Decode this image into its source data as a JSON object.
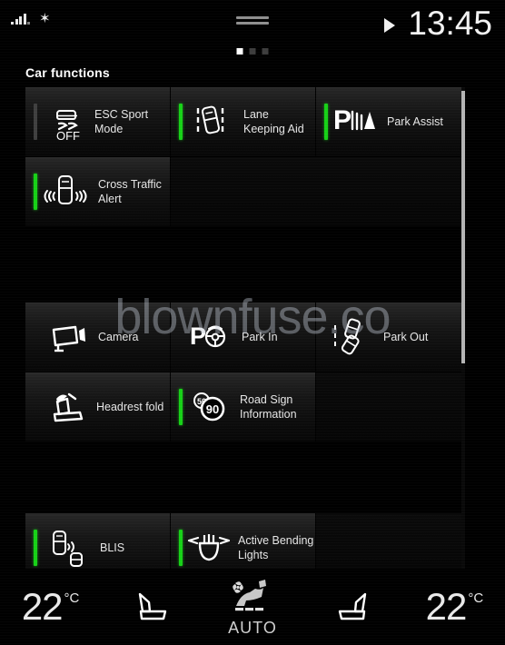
{
  "status_bar": {
    "signal_icon": "cellular-signal-icon",
    "bluetooth_icon": "bluetooth-icon",
    "bluetooth_glyph": "✶",
    "media_play_icon": "play-icon",
    "clock": "13:45",
    "drag_handle_icon": "drag-handle-icon"
  },
  "page_dots": {
    "count": 3,
    "active_index": 0
  },
  "header": {
    "title": "Car functions"
  },
  "scrollbar": {
    "name": "vertical-scrollbar",
    "position": "top"
  },
  "watermark": {
    "text": "blownfuse.co"
  },
  "tiles": {
    "rows": [
      {
        "row_name": "row-1",
        "items": [
          {
            "label": "ESC Sport Mode",
            "icon": "esc-sport-mode-icon",
            "status": "off",
            "sub_text": "OFF"
          },
          {
            "label": "Lane Keeping Aid",
            "icon": "lane-keeping-aid-icon",
            "status": "on"
          },
          {
            "label": "Park Assist",
            "icon": "park-assist-icon",
            "status": "on"
          }
        ]
      },
      {
        "row_name": "row-2",
        "items": [
          {
            "label": "Cross Traffic Alert",
            "icon": "cross-traffic-alert-icon",
            "status": "on"
          },
          {
            "label": "",
            "icon": "",
            "status": "none"
          },
          {
            "label": "",
            "icon": "",
            "status": "none"
          }
        ]
      },
      {
        "row_name": "row-3",
        "items": [
          {
            "label": "Camera",
            "icon": "camera-icon",
            "status": "none"
          },
          {
            "label": "Park In",
            "icon": "park-in-icon",
            "status": "none"
          },
          {
            "label": "Park Out",
            "icon": "park-out-icon",
            "status": "none"
          }
        ]
      },
      {
        "row_name": "row-4",
        "items": [
          {
            "label": "Headrest fold",
            "icon": "headrest-fold-icon",
            "status": "none"
          },
          {
            "label": "Road Sign Information",
            "icon": "road-sign-information-icon",
            "status": "on",
            "sign_small": "50",
            "sign_large": "90"
          },
          {
            "label": "",
            "icon": "",
            "status": "none"
          }
        ]
      },
      {
        "row_name": "row-5",
        "items": [
          {
            "label": "BLIS",
            "icon": "blis-icon",
            "status": "on"
          },
          {
            "label": "Active Bending Lights",
            "icon": "active-bending-lights-icon",
            "status": "on"
          },
          {
            "label": "",
            "icon": "",
            "status": "none"
          }
        ]
      }
    ]
  },
  "climate": {
    "left_temperature": "22",
    "left_unit": "°C",
    "left_seat_icon": "driver-seat-heater-icon",
    "fan_icon": "fan-icon",
    "auto_seat_icon": "airflow-seat-icon",
    "auto_label": "AUTO",
    "right_seat_icon": "passenger-seat-heater-icon",
    "right_temperature": "22",
    "right_unit": "°C"
  },
  "colors": {
    "active_green": "#17d117",
    "inactive_gray": "#3f3f3f",
    "text": "#e6e6e6",
    "background": "#000000"
  }
}
